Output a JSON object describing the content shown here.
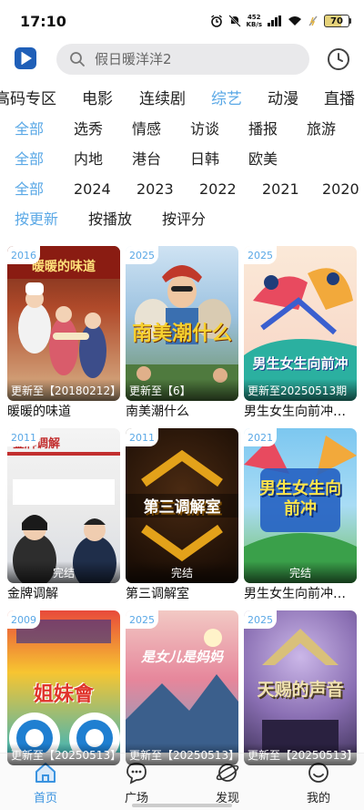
{
  "status_bar": {
    "time": "17:10",
    "net_speed_value": "452",
    "net_speed_unit": "KB/s",
    "signal": "5G",
    "battery": "70"
  },
  "search": {
    "placeholder": "假日暖洋洋2"
  },
  "category_tabs": [
    "高码专区",
    "电影",
    "连续剧",
    "综艺",
    "动漫",
    "直播"
  ],
  "genre_filters": [
    "全部",
    "选秀",
    "情感",
    "访谈",
    "播报",
    "旅游"
  ],
  "region_filters": [
    "全部",
    "内地",
    "港台",
    "日韩",
    "欧美"
  ],
  "year_filters": [
    "全部",
    "2024",
    "2023",
    "2022",
    "2021",
    "2020"
  ],
  "sort_filters": [
    "按更新",
    "按播放",
    "按评分"
  ],
  "active": {
    "category": "综艺",
    "genre": "全部",
    "region": "全部",
    "year": "全部",
    "sort": "按更新"
  },
  "items": [
    {
      "year": "2016",
      "status": "更新至【20180212】",
      "title": "暖暖的味道",
      "poster_text": "暖暖的味道",
      "accent": "#c8321e"
    },
    {
      "year": "2025",
      "status": "更新至【6】",
      "title": "南美潮什么",
      "poster_text": "南美潮什么",
      "accent": "#2f7fc9"
    },
    {
      "year": "2025",
      "status": "更新至20250513期",
      "title": "男生女生向前冲…",
      "poster_text": "男生女生向前冲",
      "accent": "#e84a5f"
    },
    {
      "year": "2011",
      "status": "完结",
      "title": "金牌调解",
      "poster_text": "金牌调解",
      "accent": "#c22f2f"
    },
    {
      "year": "2011",
      "status": "完结",
      "title": "第三调解室",
      "poster_text": "第三调解室",
      "accent": "#e3a21a"
    },
    {
      "year": "2021",
      "status": "完结",
      "title": "男生女生向前冲…",
      "poster_text": "男生女生向前冲",
      "accent": "#3aa04a"
    },
    {
      "year": "2009",
      "status": "更新至【20250513】",
      "title": "",
      "poster_text": "姐妹會",
      "accent": "#e0342b"
    },
    {
      "year": "2025",
      "status": "更新至【20250513】",
      "title": "",
      "poster_text": "是女儿是妈妈",
      "accent": "#e6869b"
    },
    {
      "year": "2025",
      "status": "更新至【20250513】",
      "title": "",
      "poster_text": "天赐的声音",
      "accent": "#b69a55"
    }
  ],
  "bottom_nav": [
    {
      "label": "首页",
      "icon": "home-icon",
      "active": true
    },
    {
      "label": "广场",
      "icon": "chat-bubble-icon",
      "active": false
    },
    {
      "label": "发现",
      "icon": "planet-icon",
      "active": false
    },
    {
      "label": "我的",
      "icon": "smiley-icon",
      "active": false
    }
  ],
  "colors": {
    "accent": "#5aa8e6",
    "nav_active": "#3a93e0",
    "logo": "#1f5fb8"
  }
}
